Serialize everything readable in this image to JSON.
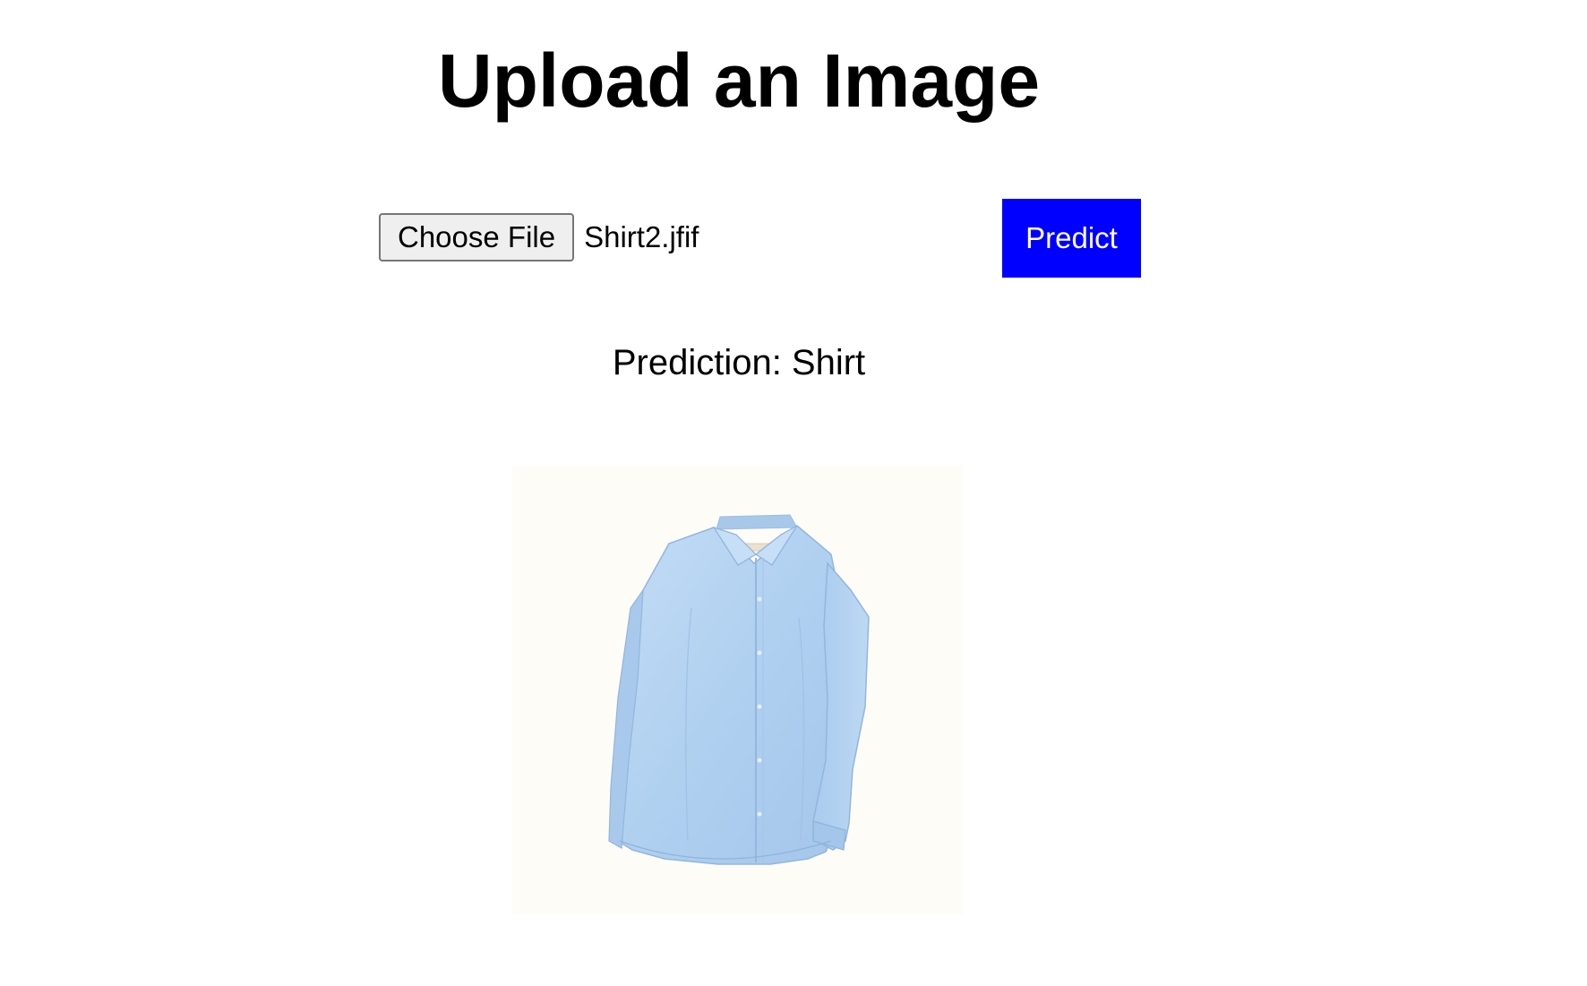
{
  "page": {
    "title": "Upload an Image"
  },
  "upload": {
    "choose_label": "Choose File",
    "file_name": "Shirt2.jfif",
    "predict_label": "Predict"
  },
  "result": {
    "prediction_text": "Prediction: Shirt",
    "image_subject": "light blue long-sleeve button-down shirt"
  },
  "colors": {
    "predict_button": "#0000ff",
    "shirt": "#b3d3f2",
    "preview_background": "#fefcf7"
  }
}
